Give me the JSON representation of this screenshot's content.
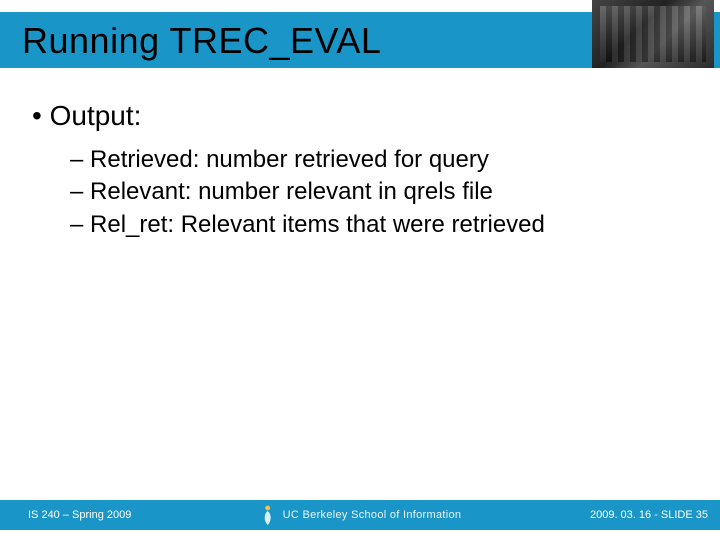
{
  "title": "Running TREC_EVAL",
  "body": {
    "heading": "Output:",
    "items": [
      "Retrieved:  number retrieved for query",
      "Relevant:  number relevant in qrels file",
      "Rel_ret: Relevant items that were retrieved"
    ]
  },
  "footer": {
    "left": "IS 240 – Spring 2009",
    "center": "UC Berkeley School of Information",
    "right": "2009. 03. 16 -  SLIDE 35"
  }
}
